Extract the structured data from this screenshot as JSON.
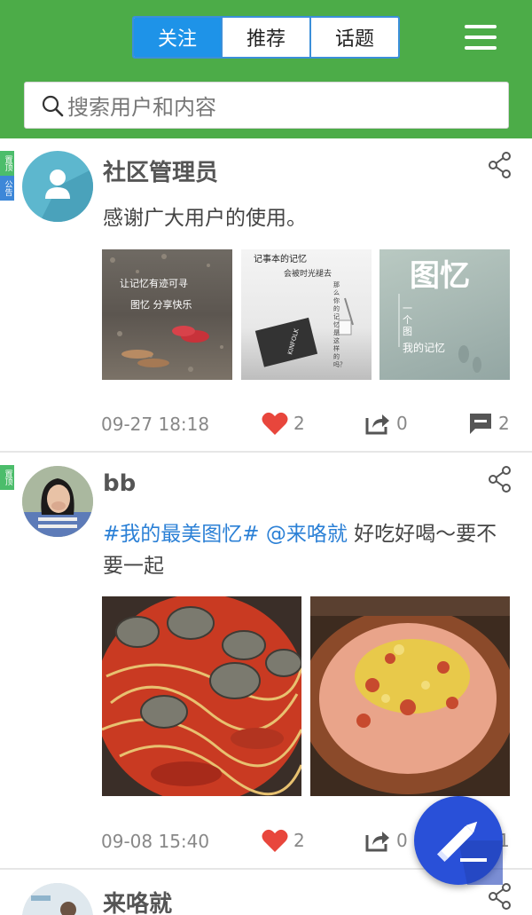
{
  "header": {
    "tabs": [
      {
        "label": "关注",
        "active": true
      },
      {
        "label": "推荐",
        "active": false
      },
      {
        "label": "话题",
        "active": false
      }
    ],
    "menu_icon": "hamburger-menu-icon",
    "search": {
      "placeholder": "搜索用户和内容",
      "icon": "search-icon"
    }
  },
  "posts": [
    {
      "username": "社区管理员",
      "badges": [
        "置顶",
        "公告"
      ],
      "content": "感谢广大用户的使用。",
      "images": [
        {
          "caption_lines": [
            "让记忆有迹可寻",
            "图忆 分享快乐"
          ]
        },
        {
          "caption_lines": [
            "记事本的记忆",
            "会被时光褪去",
            "那么你的记忆是这样的吗？"
          ],
          "book_text": "KINFOLK"
        },
        {
          "caption_lines": [
            "图忆",
            "一个图",
            "我的记忆"
          ]
        }
      ],
      "time": "09-27 18:18",
      "likes": "2",
      "shares": "0",
      "comments": "2"
    },
    {
      "username": "bb",
      "badges": [
        "置顶"
      ],
      "content_tags": [
        "#我的最美图忆#",
        "@来咯就"
      ],
      "content_text": " 好吃好喝～要不要一起",
      "time": "09-08 15:40",
      "likes": "2",
      "shares": "0",
      "comments": "1"
    },
    {
      "username": "来咯就"
    }
  ],
  "colors": {
    "header_green": "#4cac48",
    "tab_active_blue": "#1e93e8",
    "like_red": "#e8463c",
    "link_blue": "#2b80d6",
    "fab_blue": "#2950d8"
  },
  "fab": {
    "icon": "pencil-compose-icon"
  }
}
